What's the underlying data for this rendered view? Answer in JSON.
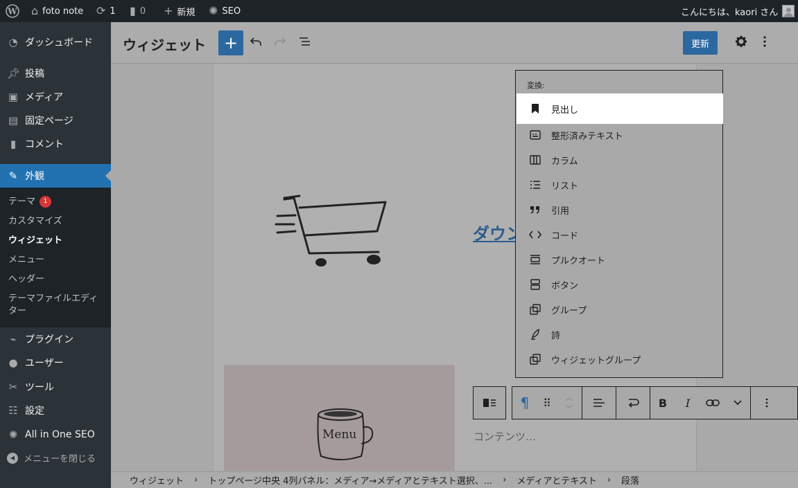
{
  "adminbar": {
    "site_name": "foto note",
    "updates_count": "1",
    "comments_count": "0",
    "new_label": "新規",
    "seo_label": "SEO",
    "greeting": "こんにちは、kaori さん"
  },
  "sidebar": {
    "items": [
      {
        "label": "ダッシュボード",
        "icon": "dashboard-icon"
      },
      {
        "label": "投稿",
        "icon": "pin-icon"
      },
      {
        "label": "メディア",
        "icon": "media-icon"
      },
      {
        "label": "固定ページ",
        "icon": "page-icon"
      },
      {
        "label": "コメント",
        "icon": "comment-icon"
      },
      {
        "label": "外観",
        "icon": "brush-icon"
      },
      {
        "label": "プラグイン",
        "icon": "plugin-icon"
      },
      {
        "label": "ユーザー",
        "icon": "user-icon"
      },
      {
        "label": "ツール",
        "icon": "wrench-icon"
      },
      {
        "label": "設定",
        "icon": "settings-icon"
      },
      {
        "label": "All in One SEO",
        "icon": "seo-icon"
      }
    ],
    "submenu": [
      {
        "label": "テーマ",
        "badge": "1"
      },
      {
        "label": "カスタマイズ"
      },
      {
        "label": "ウィジェット"
      },
      {
        "label": "メニュー"
      },
      {
        "label": "ヘッダー"
      },
      {
        "label": "テーマファイルエディター"
      }
    ],
    "collapse_label": "メニューを閉じる"
  },
  "header": {
    "title": "ウィジェット",
    "update_label": "更新"
  },
  "canvas": {
    "link_text": "ダウンロード",
    "mug_text": "Menu",
    "content_placeholder": "コンテンツ…"
  },
  "dropdown": {
    "label": "変換:",
    "items": [
      {
        "label": "見出し",
        "icon": "bookmark-icon"
      },
      {
        "label": "整形済みテキスト",
        "icon": "preformatted-icon"
      },
      {
        "label": "カラム",
        "icon": "columns-icon"
      },
      {
        "label": "リスト",
        "icon": "list-icon"
      },
      {
        "label": "引用",
        "icon": "quote-icon"
      },
      {
        "label": "コード",
        "icon": "code-icon"
      },
      {
        "label": "プルクオート",
        "icon": "pullquote-icon"
      },
      {
        "label": "ボタン",
        "icon": "buttons-icon"
      },
      {
        "label": "グループ",
        "icon": "group-icon"
      },
      {
        "label": "詩",
        "icon": "verse-icon"
      },
      {
        "label": "ウィジェットグループ",
        "icon": "widget-group-icon"
      }
    ]
  },
  "breadcrumb": [
    "ウィジェット",
    "トップページ中央 4列パネル：メディア→メディアとテキスト選択、...",
    "メディアとテキスト",
    "段落"
  ]
}
